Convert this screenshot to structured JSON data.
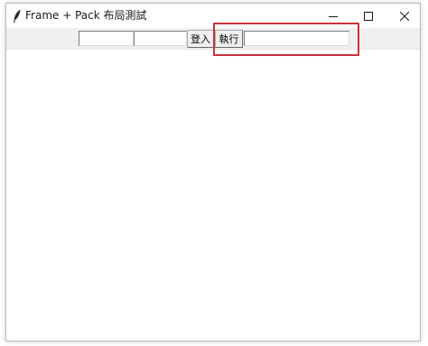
{
  "window": {
    "title": "Frame + Pack 布局測試"
  },
  "title_controls": {
    "minimize_icon": "minimize-icon",
    "maximize_icon": "maximize-icon",
    "close_icon": "close-icon"
  },
  "toolbar": {
    "entry_1_value": "",
    "entry_2_value": "",
    "login_label": "登入",
    "run_label": "執行",
    "entry_3_value": ""
  },
  "colors": {
    "highlight": "#c9323a",
    "toolbar_bg": "#f0f0f0"
  }
}
